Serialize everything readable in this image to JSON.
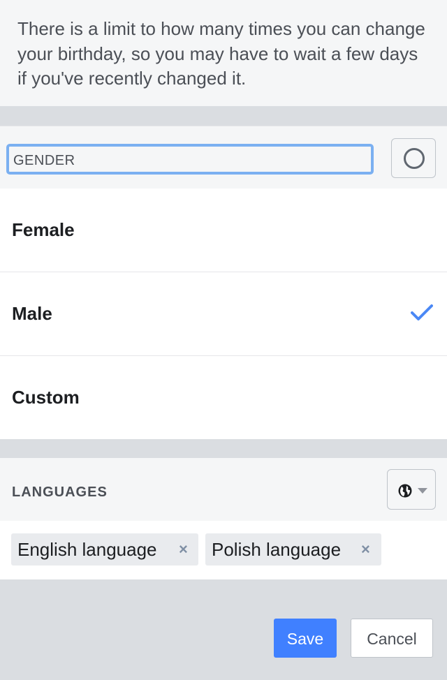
{
  "birthday_note": "There is a limit to how many times you can change your birthday, so you may have to wait a few days if you've recently changed it.",
  "gender": {
    "header_label": "GENDER",
    "privacy_icon": "circle-icon",
    "options": [
      {
        "label": "Female",
        "selected": false
      },
      {
        "label": "Male",
        "selected": true
      },
      {
        "label": "Custom",
        "selected": false
      }
    ]
  },
  "languages": {
    "header_label": "LANGUAGES",
    "privacy_icon": "globe-icon",
    "tags": [
      "English language",
      "Polish language"
    ],
    "remove_icon": "×"
  },
  "actions": {
    "save_label": "Save",
    "cancel_label": "Cancel"
  },
  "colors": {
    "accent": "#4080ff",
    "check": "#4a88f5",
    "focus_ring": "#7bb0f1"
  }
}
